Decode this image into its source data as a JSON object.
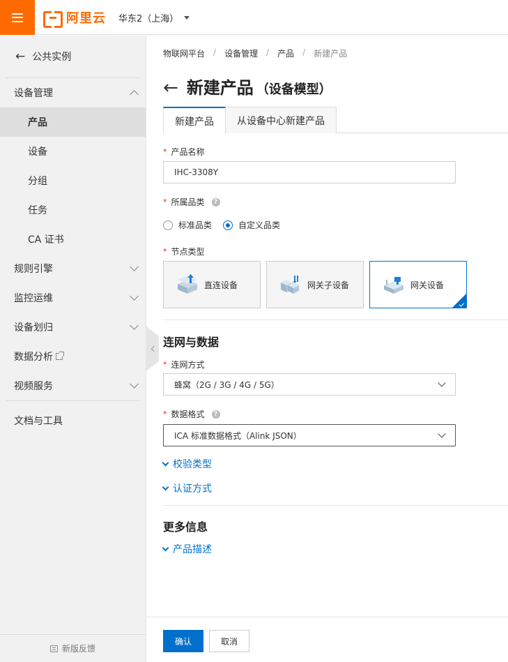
{
  "header": {
    "brand": "阿里云",
    "region": "华东2（上海）"
  },
  "sidebar": {
    "back_label": "公共实例",
    "groups": [
      {
        "label": "设备管理",
        "expanded": true,
        "items": [
          "产品",
          "设备",
          "分组",
          "任务",
          "CA 证书"
        ]
      },
      {
        "label": "规则引擎"
      },
      {
        "label": "监控运维"
      },
      {
        "label": "设备划归"
      },
      {
        "label": "数据分析"
      },
      {
        "label": "视频服务"
      }
    ],
    "active_item": "产品",
    "docs": "文档与工具",
    "feedback": "新版反馈"
  },
  "breadcrumb": [
    "物联网平台",
    "设备管理",
    "产品",
    "新建产品"
  ],
  "page": {
    "title": "新建产品",
    "subtitle": "（设备模型）"
  },
  "tabs": [
    {
      "label": "新建产品",
      "active": true
    },
    {
      "label": "从设备中心新建产品",
      "active": false
    }
  ],
  "form": {
    "product_name_label": "产品名称",
    "product_name_value": "IHC-3308Y",
    "category_label": "所属品类",
    "category_options": [
      "标准品类",
      "自定义品类"
    ],
    "category_selected": "自定义品类",
    "node_type_label": "节点类型",
    "node_types": [
      "直连设备",
      "网关子设备",
      "网关设备"
    ],
    "node_type_selected": "网关设备",
    "network_section": "连网与数据",
    "network_method_label": "连网方式",
    "network_method_value": "蜂窝（2G / 3G / 4G / 5G）",
    "data_format_label": "数据格式",
    "data_format_value": "ICA 标准数据格式（Alink JSON）",
    "verify_type": "校验类型",
    "auth_method": "认证方式",
    "more_info_section": "更多信息",
    "product_desc": "产品描述"
  },
  "footer": {
    "confirm": "确认",
    "cancel": "取消"
  },
  "colors": {
    "brand": "#ff6a00",
    "primary": "#0070cc",
    "required": "#e62412"
  }
}
